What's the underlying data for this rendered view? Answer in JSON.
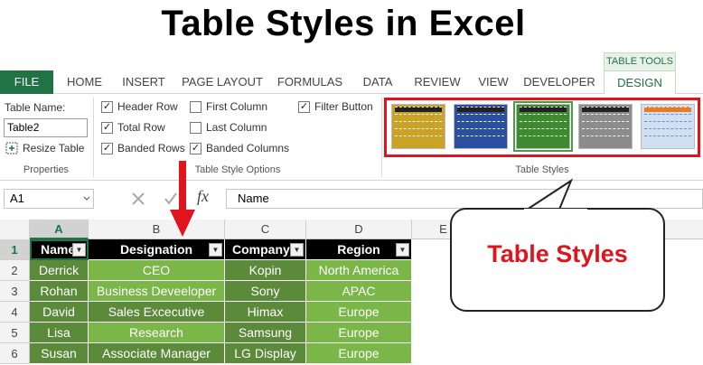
{
  "page_title": "Table Styles in Excel",
  "ribbon": {
    "file_tab": "FILE",
    "tabs": [
      "HOME",
      "INSERT",
      "PAGE LAYOUT",
      "FORMULAS",
      "DATA",
      "REVIEW",
      "VIEW",
      "DEVELOPER"
    ],
    "contextual_label": "TABLE TOOLS",
    "active_tab": "DESIGN",
    "properties": {
      "table_name_label": "Table Name:",
      "table_name_value": "Table2",
      "resize_label": "Resize Table",
      "group_label": "Properties"
    },
    "style_options": {
      "header_row": "Header Row",
      "total_row": "Total Row",
      "banded_rows": "Banded Rows",
      "first_column": "First Column",
      "last_column": "Last Column",
      "banded_columns": "Banded Columns",
      "filter_button": "Filter Button",
      "group_label": "Table Style Options",
      "checked": {
        "header_row": true,
        "total_row": true,
        "banded_rows": true,
        "first_column": false,
        "last_column": false,
        "banded_columns": true,
        "filter_button": true
      }
    },
    "table_styles": {
      "group_label": "Table Styles",
      "swatch_colors": [
        "#c9a227",
        "#2b4fa0",
        "#3e8a2e",
        "#8c8c8c",
        "#e97a26"
      ],
      "selected_index": 2
    }
  },
  "formula_bar": {
    "name_box": "A1",
    "fx": "fx",
    "content": "Name"
  },
  "grid": {
    "columns": [
      "A",
      "B",
      "C",
      "D",
      "E"
    ],
    "rows": [
      "1",
      "2",
      "3",
      "4",
      "5",
      "6"
    ],
    "header": [
      "Name",
      "Designation",
      "Company",
      "Region"
    ],
    "data": [
      [
        "Derrick",
        "CEO",
        "Kopin",
        "North America"
      ],
      [
        "Rohan",
        "Business Deveeloper",
        "Sony",
        "APAC"
      ],
      [
        "David",
        "Sales Excecutive",
        "Himax",
        "Europe"
      ],
      [
        "Lisa",
        "Research",
        "Samsung",
        "Europe"
      ],
      [
        "Susan",
        "Associate Manager",
        "LG Display",
        "Europe"
      ]
    ]
  },
  "callout": {
    "text": "Table Styles"
  },
  "colors": {
    "excel_green": "#217346",
    "highlight_red": "#e0141c",
    "table_dark": "#5a8a3a",
    "table_light": "#7ab648"
  }
}
